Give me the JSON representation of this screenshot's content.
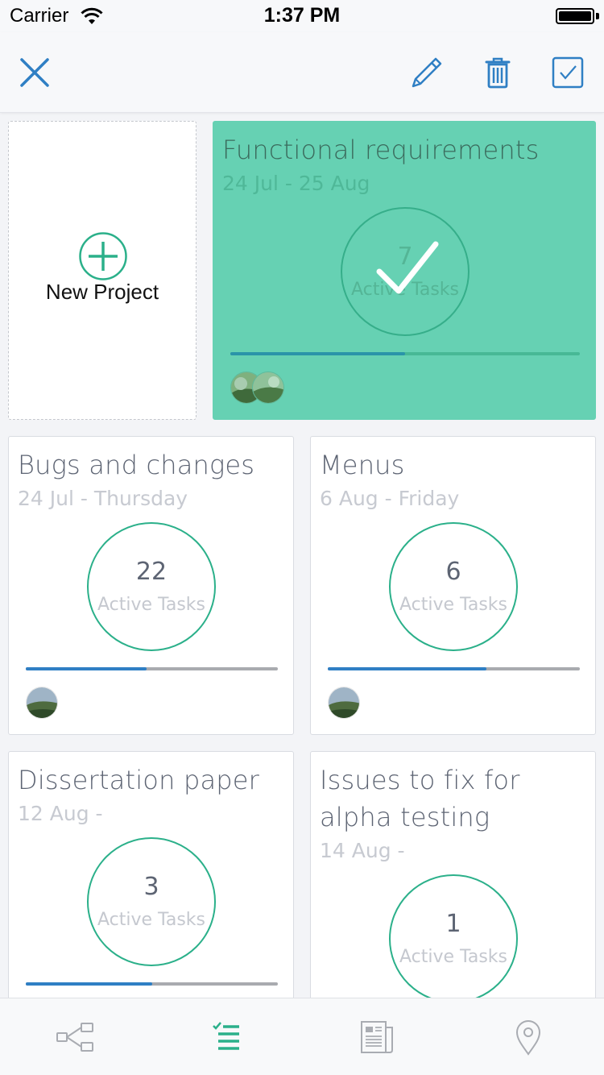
{
  "status_bar": {
    "carrier": "Carrier",
    "time": "1:37 PM"
  },
  "toolbar": {
    "close_icon": "close-icon",
    "edit_icon": "pencil-icon",
    "delete_icon": "trash-icon",
    "select_icon": "checkbox-icon",
    "accent": "#2f7fc4"
  },
  "new_project": {
    "label": "New Project"
  },
  "projects": [
    {
      "title": "Functional requirements",
      "date": "24 Jul - 25 Aug",
      "count": "7",
      "label": "Active Tasks",
      "progress": 0.5,
      "selected": true
    },
    {
      "title": "Bugs and changes",
      "date": "24 Jul - Thursday",
      "count": "22",
      "label": "Active Tasks",
      "progress": 0.48,
      "selected": false
    },
    {
      "title": "Menus",
      "date": "6 Aug - Friday",
      "count": "6",
      "label": "Active Tasks",
      "progress": 0.63,
      "selected": false
    },
    {
      "title": "Dissertation paper",
      "date": "12 Aug -",
      "count": "3",
      "label": "Active Tasks",
      "progress": 0.5,
      "selected": false
    },
    {
      "title": "Issues to fix for alpha testing",
      "date": "14 Aug -",
      "count": "1",
      "label": "Active Tasks",
      "progress": null,
      "selected": false
    }
  ],
  "colors": {
    "teal": "#2bb08a",
    "selected_bg": "#66d1b3",
    "progress_blue": "#2f7fc4"
  },
  "tabbar": {
    "tabs": [
      "hierarchy-icon",
      "task-list-icon",
      "news-icon",
      "location-pin-icon"
    ],
    "active_index": 1
  }
}
